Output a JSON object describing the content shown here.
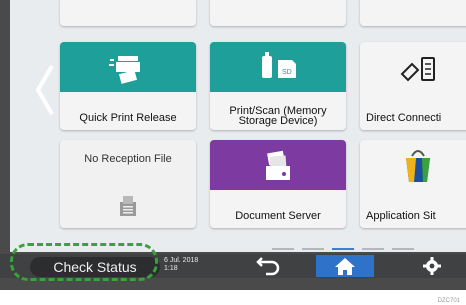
{
  "colors": {
    "teal": "#1f9f9a",
    "purple": "#7d3aa0",
    "home_blue": "#2f72c9",
    "highlight_green": "#3aa23a"
  },
  "tiles": [
    {
      "label": "Quick Print Release",
      "icon": "print-release-icon"
    },
    {
      "label_line1": "Print/Scan (Memory",
      "label_line2": "Storage Device)",
      "icon": "usb-sd-icon"
    },
    {
      "label": "Direct Connecti",
      "icon": "direct-connection-icon"
    },
    {
      "label": "No Reception File",
      "icon": "fax-icon"
    },
    {
      "label": "Document Server",
      "icon": "document-server-icon"
    },
    {
      "label": "Application Sit",
      "icon": "application-site-icon"
    }
  ],
  "bottom_bar": {
    "check_status": "Check Status",
    "date": "6 Jul. 2018",
    "time": "1:18"
  },
  "figure_id": "DZC701"
}
